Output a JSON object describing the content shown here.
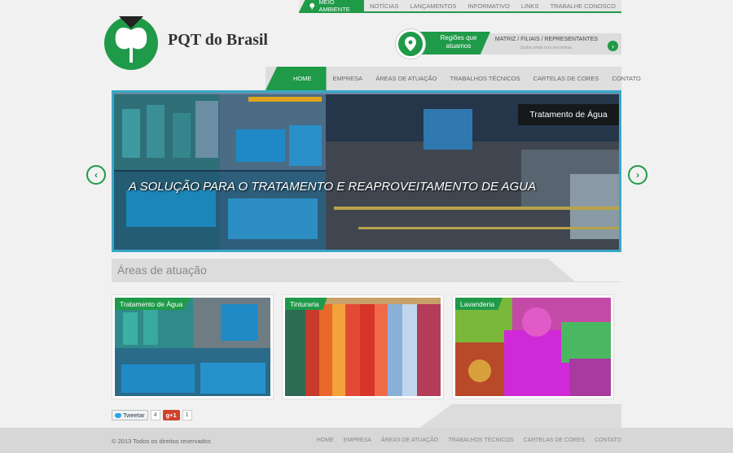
{
  "top_bar": {
    "env_label": "MEIO AMBIENTE",
    "links": [
      "NOTÍCIAS",
      "LANÇAMENTOS",
      "INFORMATIVO",
      "LINKS",
      "TRABALHE CONOSCO"
    ]
  },
  "brand": {
    "name": "PQT do Brasil"
  },
  "region": {
    "label": "Regiões que atuamos",
    "title": "MATRIZ / FILIAIS / REPRESENTANTES",
    "subtitle": "Saiba onde nos encontrar."
  },
  "nav": {
    "items": [
      "HOME",
      "EMPRESA",
      "ÁREAS DE ATUAÇÃO",
      "TRABALHOS TÉCNICOS",
      "CARTELAS DE CORES",
      "CONTATO"
    ]
  },
  "slider": {
    "caption": "Tratamento de Água",
    "headline": "A SOLUÇÃO PARA O TRATAMENTO E REAPROVEITAMENTO DE AGUA"
  },
  "section": {
    "title": "Áreas de atuação"
  },
  "cards": [
    {
      "label": "Tratamento de Água"
    },
    {
      "label": "Tinturaria"
    },
    {
      "label": "Lavanderia"
    }
  ],
  "social": {
    "tweet_label": "Tweetar",
    "tweet_count": "4",
    "gplus_label": "g+1",
    "gplus_count": "1"
  },
  "footer": {
    "copyright": "© 2013 Todos os direitos reservados",
    "links": [
      "HOME",
      "EMPRESA",
      "ÁREAS DE ATUAÇÃO",
      "TRABALHOS TÉCNICOS",
      "CARTELAS DE CORES",
      "CONTATO"
    ]
  },
  "colors": {
    "accent": "#1f9a48",
    "slider_border": "#3aa7c7"
  }
}
